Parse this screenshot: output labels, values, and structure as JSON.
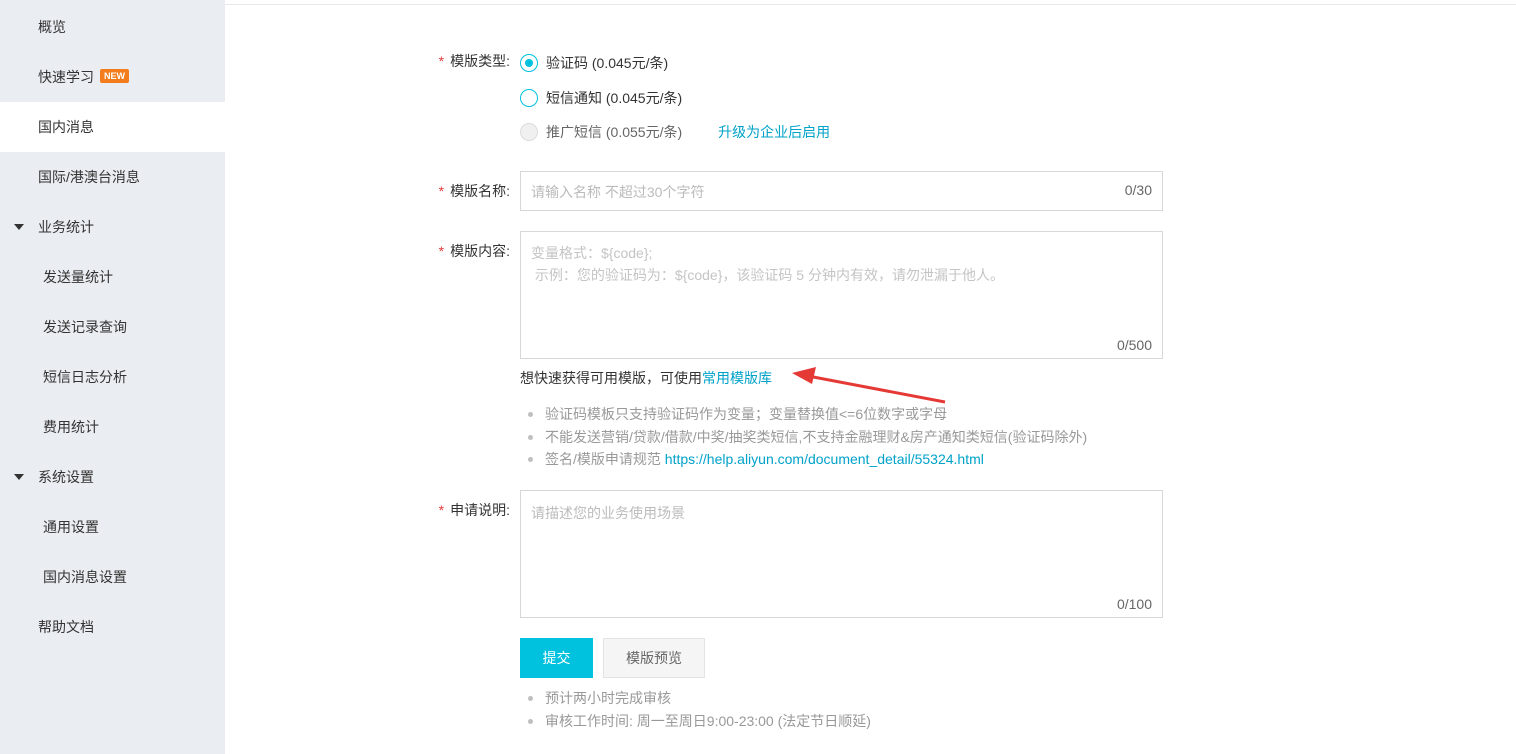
{
  "sidebar": {
    "items": [
      {
        "label": "概览"
      },
      {
        "label": "快速学习",
        "badge": "NEW"
      },
      {
        "label": "国内消息"
      },
      {
        "label": "国际/港澳台消息"
      },
      {
        "label": "业务统计"
      },
      {
        "label": "发送量统计"
      },
      {
        "label": "发送记录查询"
      },
      {
        "label": "短信日志分析"
      },
      {
        "label": "费用统计"
      },
      {
        "label": "系统设置"
      },
      {
        "label": "通用设置"
      },
      {
        "label": "国内消息设置"
      },
      {
        "label": "帮助文档"
      }
    ]
  },
  "form": {
    "required_mark": "*",
    "type": {
      "label": "模版类型:",
      "options": [
        {
          "label": "验证码 (0.045元/条)",
          "checked": true
        },
        {
          "label": "短信通知 (0.045元/条)",
          "checked": false
        },
        {
          "label": "推广短信 (0.055元/条)",
          "checked": false,
          "disabled": true
        }
      ],
      "upgrade_link": "升级为企业后启用"
    },
    "name": {
      "label": "模版名称:",
      "placeholder": "请输入名称 不超过30个字符",
      "counter": "0/30"
    },
    "content": {
      "label": "模版内容:",
      "placeholder_line1": "变量格式：${code};",
      "placeholder_line2": " 示例：您的验证码为：${code}，该验证码 5 分钟内有效，请勿泄漏于他人。",
      "counter": "0/500",
      "quick_hint": "想快速获得可用模版，可使用",
      "quick_link": "常用模版库",
      "notes": [
        {
          "text": "验证码模板只支持验证码作为变量；变量替换值<=6位数字或字母"
        },
        {
          "text": "不能发送营销/贷款/借款/中奖/抽奖类短信,不支持金融理财&房产通知类短信(验证码除外)"
        },
        {
          "text": "签名/模版申请规范 ",
          "link": "https://help.aliyun.com/document_detail/55324.html"
        }
      ]
    },
    "description": {
      "label": "申请说明:",
      "placeholder": "请描述您的业务使用场景",
      "counter": "0/100"
    },
    "buttons": {
      "submit": "提交",
      "preview": "模版预览"
    },
    "footer_notes": [
      {
        "text": "预计两小时完成审核"
      },
      {
        "text": "审核工作时间: 周一至周日9:00-23:00  (法定节日顺延)"
      }
    ]
  },
  "colors": {
    "accent": "#00c1de",
    "link": "#00a2ca",
    "required": "#e4393c",
    "annotation_arrow": "#e53935",
    "badge": "#f37c1c"
  }
}
